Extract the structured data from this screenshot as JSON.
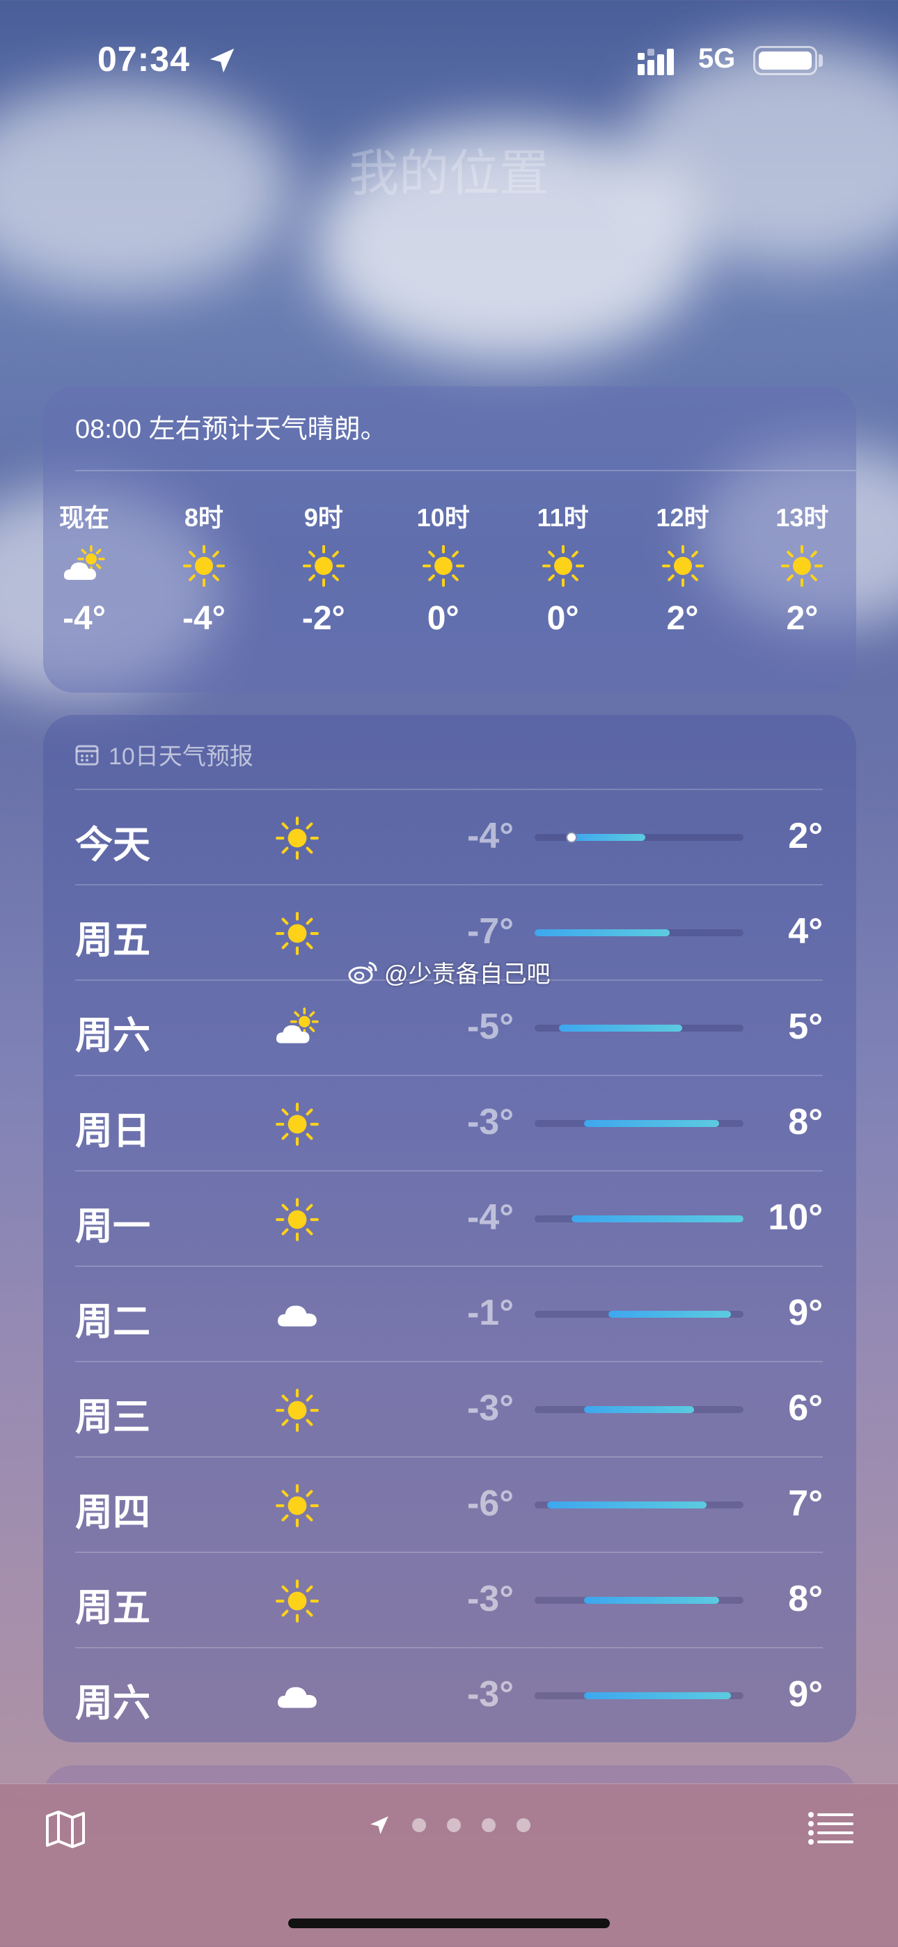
{
  "status_bar": {
    "time": "07:34",
    "network": "5G",
    "icons": [
      "location-arrow-icon",
      "signal-icon",
      "battery-icon"
    ]
  },
  "location_title": "我的位置",
  "hourly": {
    "summary": "08:00 左右预计天气晴朗。",
    "hours": [
      {
        "label": "现在",
        "icon": "partly-sunny-icon",
        "temp": "-4°"
      },
      {
        "label": "8时",
        "icon": "sun-icon",
        "temp": "-4°"
      },
      {
        "label": "9时",
        "icon": "sun-icon",
        "temp": "-2°"
      },
      {
        "label": "10时",
        "icon": "sun-icon",
        "temp": "0°"
      },
      {
        "label": "11时",
        "icon": "sun-icon",
        "temp": "0°"
      },
      {
        "label": "12时",
        "icon": "sun-icon",
        "temp": "2°"
      },
      {
        "label": "13时",
        "icon": "sun-icon",
        "temp": "2°"
      }
    ]
  },
  "daily": {
    "header": "10日天气预报",
    "range_min": -7,
    "range_max": 10,
    "current_temp": -4,
    "days": [
      {
        "name": "今天",
        "icon": "sun-icon",
        "low": "-4°",
        "high": "2°",
        "low_v": -4,
        "high_v": 2
      },
      {
        "name": "周五",
        "icon": "sun-icon",
        "low": "-7°",
        "high": "4°",
        "low_v": -7,
        "high_v": 4
      },
      {
        "name": "周六",
        "icon": "partly-sunny-icon",
        "low": "-5°",
        "high": "5°",
        "low_v": -5,
        "high_v": 5
      },
      {
        "name": "周日",
        "icon": "sun-icon",
        "low": "-3°",
        "high": "8°",
        "low_v": -3,
        "high_v": 8
      },
      {
        "name": "周一",
        "icon": "sun-icon",
        "low": "-4°",
        "high": "10°",
        "low_v": -4,
        "high_v": 10
      },
      {
        "name": "周二",
        "icon": "cloud-icon",
        "low": "-1°",
        "high": "9°",
        "low_v": -1,
        "high_v": 9
      },
      {
        "name": "周三",
        "icon": "sun-icon",
        "low": "-3°",
        "high": "6°",
        "low_v": -3,
        "high_v": 6
      },
      {
        "name": "周四",
        "icon": "sun-icon",
        "low": "-6°",
        "high": "7°",
        "low_v": -6,
        "high_v": 7
      },
      {
        "name": "周五",
        "icon": "sun-icon",
        "low": "-3°",
        "high": "8°",
        "low_v": -3,
        "high_v": 8
      },
      {
        "name": "周六",
        "icon": "cloud-icon",
        "low": "-3°",
        "high": "9°",
        "low_v": -3,
        "high_v": 9
      }
    ]
  },
  "watermark": "@少责备自己吧",
  "bottom_bar": {
    "icons": [
      "map-icon",
      "location-arrow-icon",
      "list-icon"
    ],
    "page_count": 4
  },
  "colors": {
    "sun": "#ffd21a",
    "bar_start": "#3ea7ee",
    "bar_end": "#5ccbe0"
  }
}
